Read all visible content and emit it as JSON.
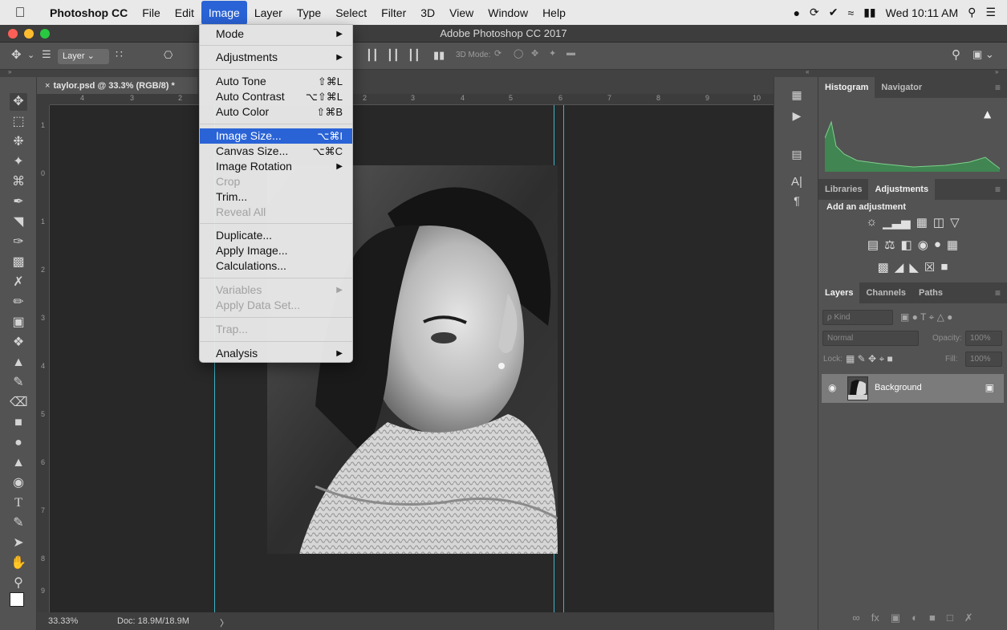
{
  "menubar": {
    "app": "Photoshop CC",
    "items": [
      "File",
      "Edit",
      "Image",
      "Layer",
      "Type",
      "Select",
      "Filter",
      "3D",
      "View",
      "Window",
      "Help"
    ],
    "active": "Image",
    "clock": "Wed 10:11 AM"
  },
  "window": {
    "title": "Adobe Photoshop CC 2017"
  },
  "options": {
    "auto_select_target": "Layer",
    "mode_3d_label": "3D Mode:"
  },
  "document": {
    "tab_title": "taylor.psd @ 33.3% (RGB/8) *",
    "ruler_h": [
      "4",
      "3",
      "2",
      "2",
      "3",
      "4",
      "5",
      "6",
      "7",
      "8",
      "9",
      "10"
    ],
    "ruler_v": [
      "1",
      "0",
      "1",
      "2",
      "3",
      "4",
      "5",
      "6",
      "7",
      "8",
      "9"
    ],
    "zoom": "33.33%",
    "doc_size": "Doc: 18.9M/18.9M",
    "status_arrow": "〉"
  },
  "image_menu": {
    "items": [
      {
        "label": "Mode",
        "submenu": true
      },
      {
        "label": "Adjustments",
        "submenu": true
      },
      {
        "label": "Auto Tone",
        "shortcut": "⇧⌘L"
      },
      {
        "label": "Auto Contrast",
        "shortcut": "⌥⇧⌘L"
      },
      {
        "label": "Auto Color",
        "shortcut": "⇧⌘B"
      },
      {
        "label": "Image Size...",
        "shortcut": "⌥⌘I",
        "highlighted": true
      },
      {
        "label": "Canvas Size...",
        "shortcut": "⌥⌘C"
      },
      {
        "label": "Image Rotation",
        "submenu": true
      },
      {
        "label": "Crop",
        "disabled": true
      },
      {
        "label": "Trim..."
      },
      {
        "label": "Reveal All",
        "disabled": true
      },
      {
        "label": "Duplicate..."
      },
      {
        "label": "Apply Image..."
      },
      {
        "label": "Calculations..."
      },
      {
        "label": "Variables",
        "submenu": true,
        "disabled": true
      },
      {
        "label": "Apply Data Set...",
        "disabled": true
      },
      {
        "label": "Trap...",
        "disabled": true
      },
      {
        "label": "Analysis",
        "submenu": true
      }
    ]
  },
  "panels": {
    "histogram_tabs": [
      "Histogram",
      "Navigator"
    ],
    "adjust_tabs": [
      "Libraries",
      "Adjustments"
    ],
    "adjust_title": "Add an adjustment",
    "layers_tabs": [
      "Layers",
      "Channels",
      "Paths"
    ],
    "kind_label": "ρ Kind",
    "blend_mode": "Normal",
    "opacity_label": "Opacity:",
    "opacity_value": "100%",
    "lock_label": "Lock:",
    "fill_label": "Fill:",
    "fill_value": "100%",
    "layer_name": "Background"
  }
}
